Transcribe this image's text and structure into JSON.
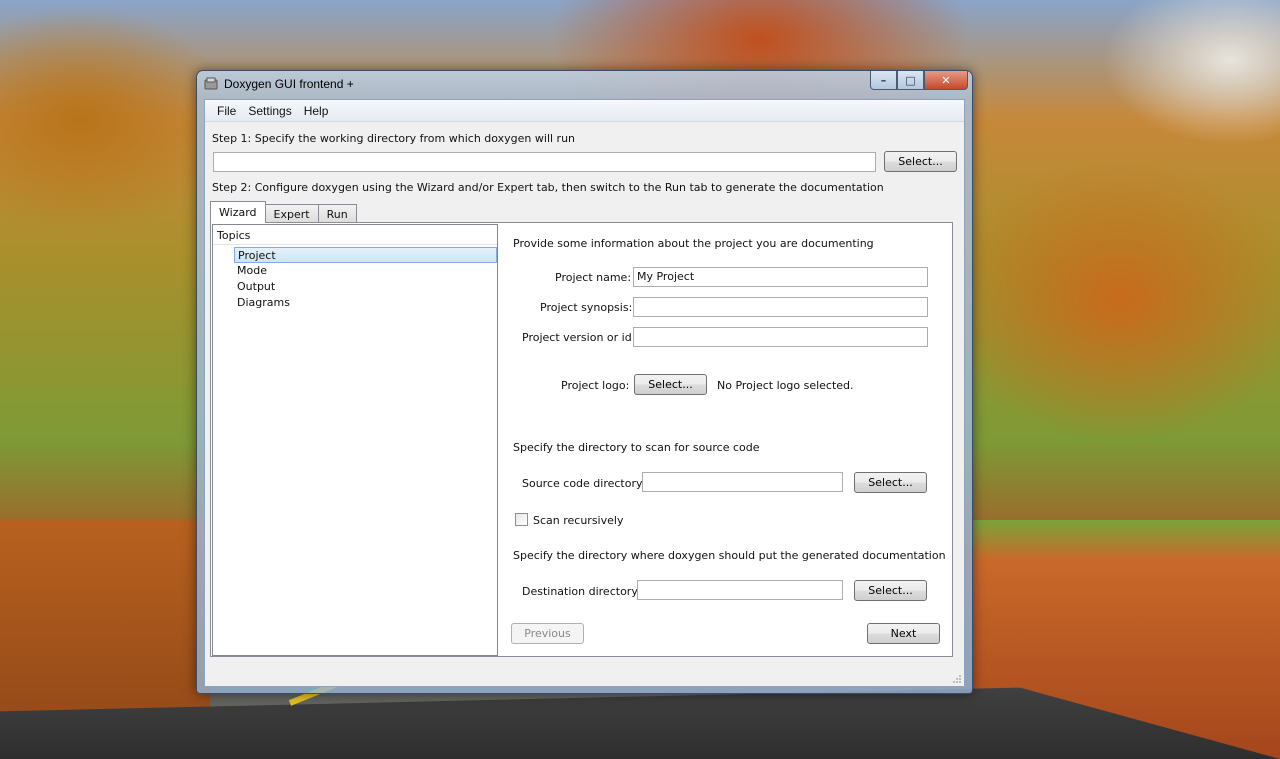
{
  "window": {
    "title": "Doxygen GUI frontend +",
    "caption_min": "–",
    "caption_max": "□",
    "caption_close": "✕"
  },
  "menu": [
    "File",
    "Settings",
    "Help"
  ],
  "step1": {
    "label": "Step 1: Specify the working directory from which doxygen will run",
    "value": "",
    "select_label": "Select..."
  },
  "step2": {
    "label": "Step 2: Configure doxygen using the Wizard and/or Expert tab, then switch to the Run tab to generate the documentation"
  },
  "tabs": [
    "Wizard",
    "Expert",
    "Run"
  ],
  "topics": {
    "header": "Topics",
    "items": [
      "Project",
      "Mode",
      "Output",
      "Diagrams"
    ],
    "selected": "Project"
  },
  "project": {
    "intro": "Provide some information about the project you are documenting",
    "name_label": "Project name:",
    "name_value": "My Project",
    "synopsis_label": "Project synopsis:",
    "synopsis_value": "",
    "version_label": "Project version or id:",
    "version_value": "",
    "logo_label": "Project logo:",
    "logo_button": "Select...",
    "logo_status": "No Project logo selected."
  },
  "source": {
    "intro": "Specify the directory to scan for source code",
    "dir_label": "Source code directory:",
    "dir_value": "",
    "select_label": "Select...",
    "recursive_label": "Scan recursively",
    "recursive_checked": false
  },
  "destination": {
    "intro": "Specify the directory where doxygen should put the generated documentation",
    "dir_label": "Destination directory:",
    "dir_value": "",
    "select_label": "Select..."
  },
  "nav": {
    "previous": "Previous",
    "next": "Next"
  }
}
